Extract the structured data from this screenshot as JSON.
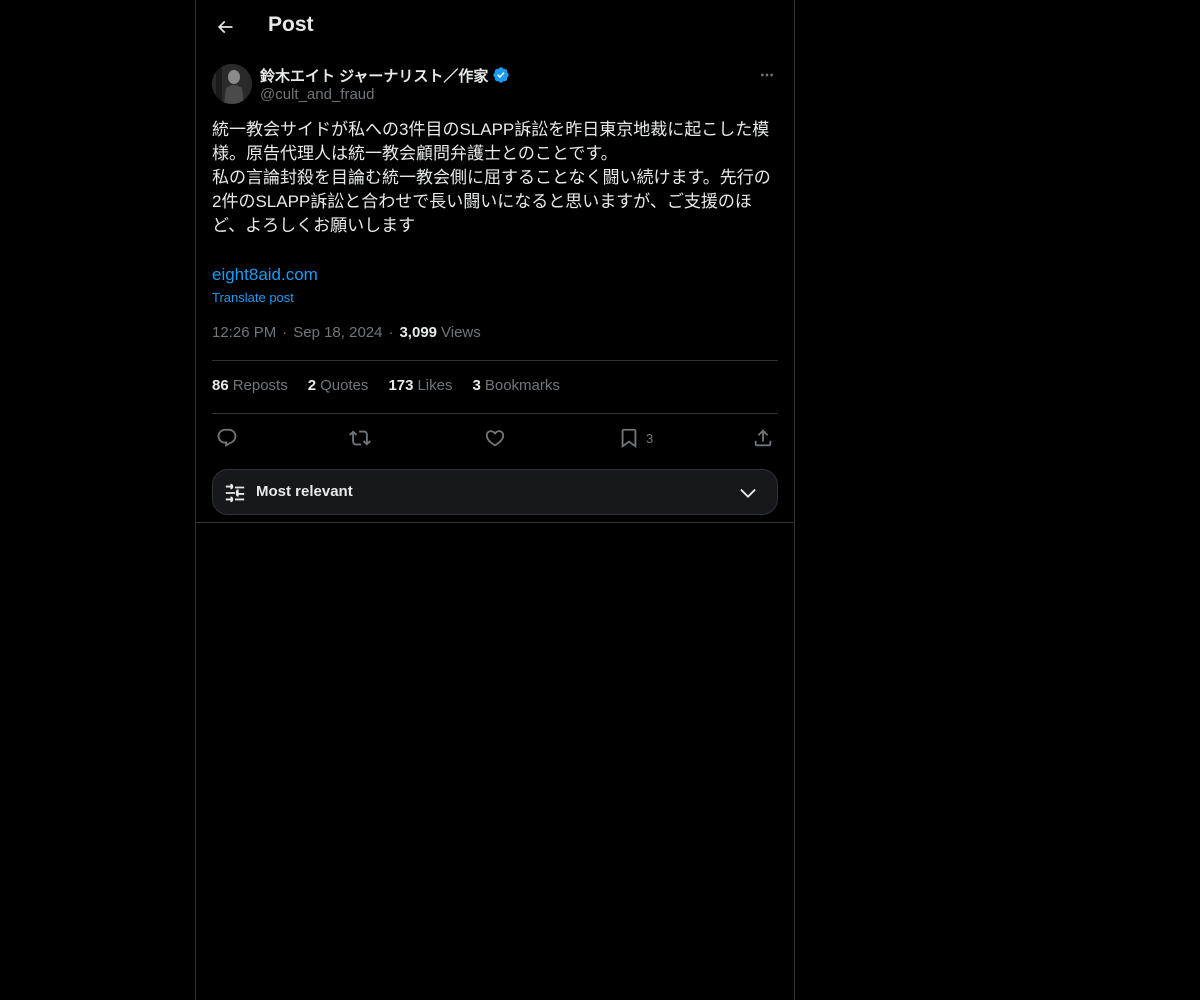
{
  "header": {
    "title": "Post",
    "back_icon": "arrow-left-icon"
  },
  "post": {
    "author": {
      "name": "鈴木エイト ジャーナリスト／作家",
      "handle": "@cult_and_fraud",
      "verified": true
    },
    "text": "統一教会サイドが私への3件目のSLAPP訴訟を昨日東京地裁に起こした模様。原告代理人は統一教会顧問弁護士とのことです。\n私の言論封殺を目論む統一教会側に屈することなく闘い続けます。先行の2件のSLAPP訴訟と合わせで長い闘いになると思いますが、ご支援のほど、よろしくお願いします",
    "link_text": "eight8aid.com",
    "translate_label": "Translate post",
    "time": "12:26 PM",
    "date": "Sep 18, 2024",
    "views_count": "3,099",
    "views_label": "Views"
  },
  "stats": {
    "reposts_count": "86",
    "reposts_label": "Reposts",
    "quotes_count": "2",
    "quotes_label": "Quotes",
    "likes_count": "173",
    "likes_label": "Likes",
    "bookmarks_count": "3",
    "bookmarks_label": "Bookmarks"
  },
  "actions": {
    "reply_icon": "reply-icon",
    "repost_icon": "repost-icon",
    "like_icon": "heart-icon",
    "bookmark_icon": "bookmark-icon",
    "bookmark_count": "3",
    "share_icon": "share-icon"
  },
  "sort": {
    "label": "Most relevant",
    "icon": "sliders-icon"
  },
  "colors": {
    "background": "#000000",
    "text": "#e7e9ea",
    "muted": "#71767b",
    "accent": "#1d9bf0",
    "border": "#2f3336"
  }
}
